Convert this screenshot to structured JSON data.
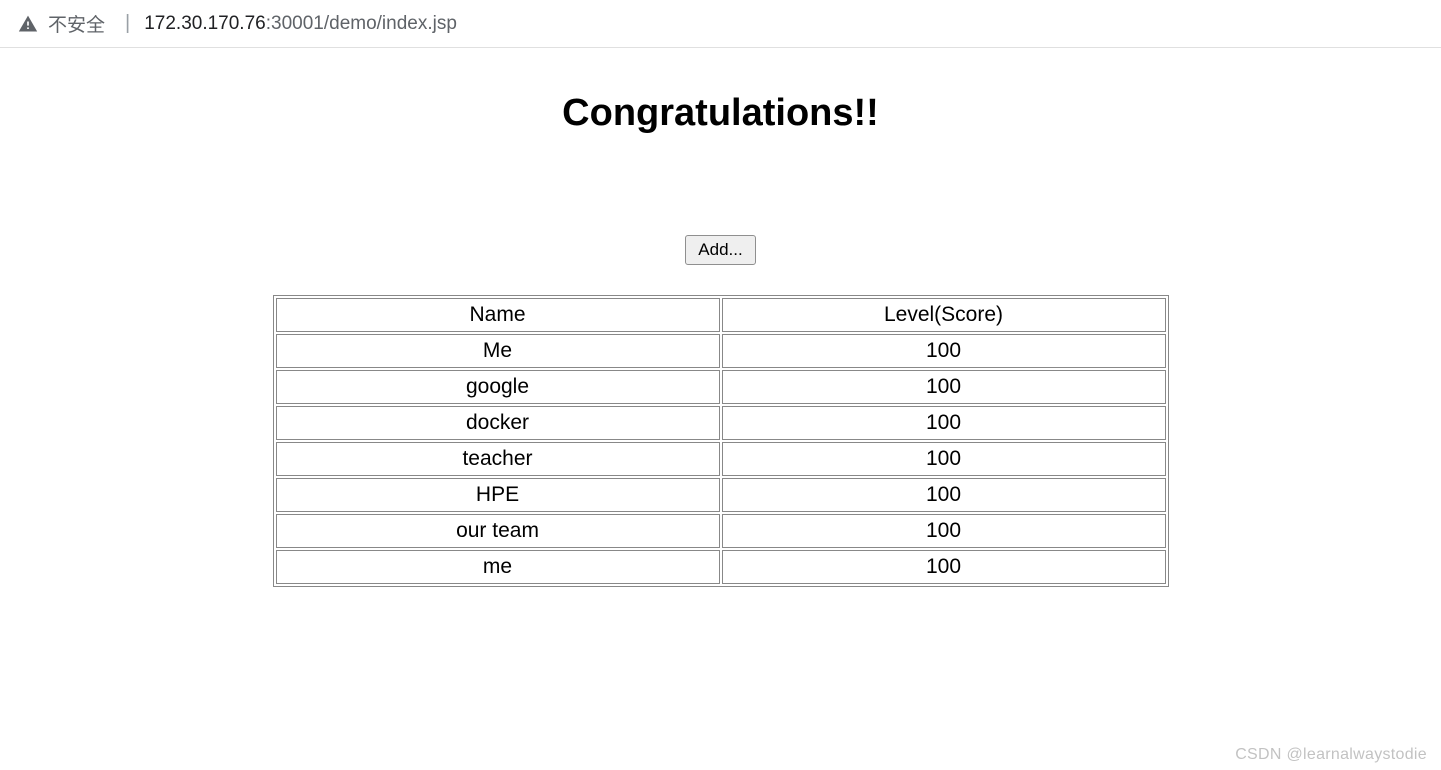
{
  "address_bar": {
    "not_secure_label": "不安全",
    "url_host": "172.30.170.76",
    "url_rest": ":30001/demo/index.jsp"
  },
  "page": {
    "title": "Congratulations!!",
    "add_button_label": "Add..."
  },
  "table": {
    "headers": {
      "name": "Name",
      "level": "Level(Score)"
    },
    "rows": [
      {
        "name": "Me",
        "level": "100"
      },
      {
        "name": "google",
        "level": "100"
      },
      {
        "name": "docker",
        "level": "100"
      },
      {
        "name": "teacher",
        "level": "100"
      },
      {
        "name": "HPE",
        "level": "100"
      },
      {
        "name": "our team",
        "level": "100"
      },
      {
        "name": "me",
        "level": "100"
      }
    ]
  },
  "watermark": "CSDN @learnalwaystodie"
}
